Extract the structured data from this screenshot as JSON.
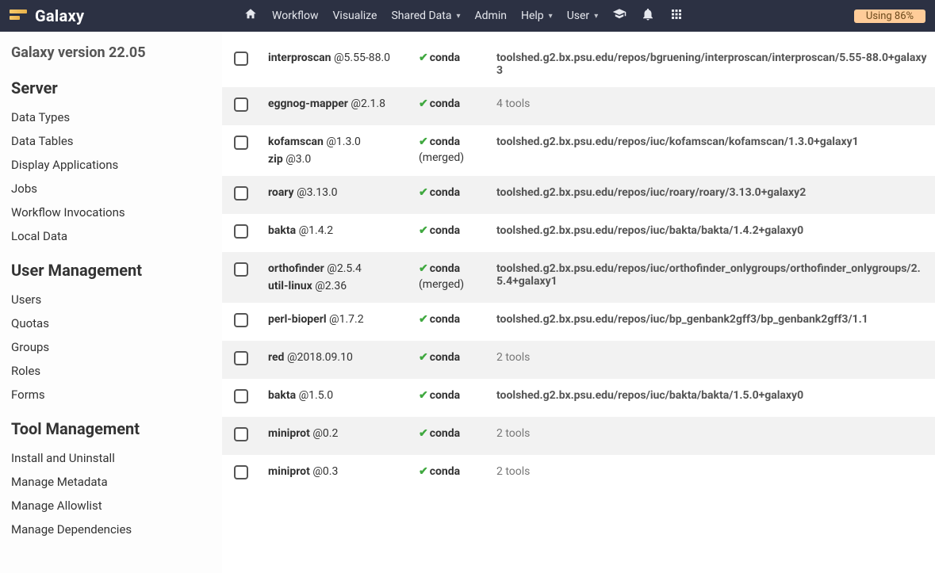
{
  "topbar": {
    "brand": "Galaxy",
    "links": [
      "Workflow",
      "Visualize",
      "Shared Data",
      "Admin",
      "Help",
      "User"
    ],
    "usage": "Using 86%"
  },
  "sidebar": {
    "version": "Galaxy version 22.05",
    "sections": [
      {
        "title": "Server",
        "items": [
          "Data Types",
          "Data Tables",
          "Display Applications",
          "Jobs",
          "Workflow Invocations",
          "Local Data"
        ]
      },
      {
        "title": "User Management",
        "items": [
          "Users",
          "Quotas",
          "Groups",
          "Roles",
          "Forms"
        ]
      },
      {
        "title": "Tool Management",
        "items": [
          "Install and Uninstall",
          "Manage Metadata",
          "Manage Allowlist",
          "Manage Dependencies"
        ]
      }
    ]
  },
  "rows": [
    {
      "name": "interproscan",
      "ver": "@5.55-88.0",
      "resolver": "conda",
      "used": "toolshed.g2.bx.psu.edu/repos/bgruening/interproscan/interproscan/5.55-88.0+galaxy3",
      "faint": false
    },
    {
      "name": "eggnog-mapper",
      "ver": "@2.1.8",
      "resolver": "conda",
      "used": "4 tools",
      "faint": true
    },
    {
      "name": "kofamscan",
      "ver": "@1.3.0",
      "name2": "zip",
      "ver2": "@3.0",
      "resolver": "conda",
      "merged": "(merged)",
      "used": "toolshed.g2.bx.psu.edu/repos/iuc/kofamscan/kofamscan/1.3.0+galaxy1",
      "faint": false
    },
    {
      "name": "roary",
      "ver": "@3.13.0",
      "resolver": "conda",
      "used": "toolshed.g2.bx.psu.edu/repos/iuc/roary/roary/3.13.0+galaxy2",
      "faint": false
    },
    {
      "name": "bakta",
      "ver": "@1.4.2",
      "resolver": "conda",
      "used": "toolshed.g2.bx.psu.edu/repos/iuc/bakta/bakta/1.4.2+galaxy0",
      "faint": false
    },
    {
      "name": "orthofinder",
      "ver": "@2.5.4",
      "name2": "util-linux",
      "ver2": "@2.36",
      "resolver": "conda",
      "merged": "(merged)",
      "used": "toolshed.g2.bx.psu.edu/repos/iuc/orthofinder_onlygroups/orthofinder_onlygroups/2.5.4+galaxy1",
      "faint": false
    },
    {
      "name": "perl-bioperl",
      "ver": "@1.7.2",
      "resolver": "conda",
      "used": "toolshed.g2.bx.psu.edu/repos/iuc/bp_genbank2gff3/bp_genbank2gff3/1.1",
      "faint": false
    },
    {
      "name": "red",
      "ver": "@2018.09.10",
      "resolver": "conda",
      "used": "2 tools",
      "faint": true
    },
    {
      "name": "bakta",
      "ver": "@1.5.0",
      "resolver": "conda",
      "used": "toolshed.g2.bx.psu.edu/repos/iuc/bakta/bakta/1.5.0+galaxy0",
      "faint": false
    },
    {
      "name": "miniprot",
      "ver": "@0.2",
      "resolver": "conda",
      "used": "2 tools",
      "faint": true
    },
    {
      "name": "miniprot",
      "ver": "@0.3",
      "resolver": "conda",
      "used": "2 tools",
      "faint": true
    }
  ]
}
